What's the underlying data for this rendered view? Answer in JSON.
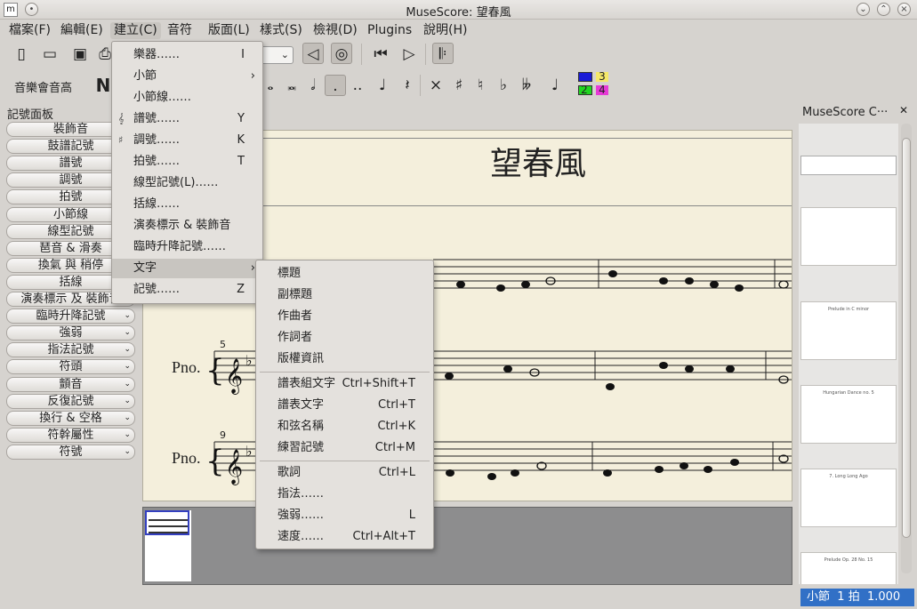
{
  "app": {
    "title": "MuseScore: 望春風"
  },
  "menubar": [
    {
      "label": "檔案(F)"
    },
    {
      "label": "編輯(E)"
    },
    {
      "label": "建立(C)"
    },
    {
      "label": "音符"
    },
    {
      "label": "版面(L)"
    },
    {
      "label": "樣式(S)"
    },
    {
      "label": "檢視(D)"
    },
    {
      "label": "Plugins"
    },
    {
      "label": "說明(H)"
    }
  ],
  "toolbar": {
    "concert_pitch": "音樂會音高",
    "voice_labels": [
      "3",
      "2",
      "4"
    ],
    "voice_colors": [
      "#1a1ad6",
      "#21d621",
      "#e63ad6"
    ]
  },
  "palette": {
    "title": "記號面板",
    "items": [
      "裝飾音",
      "鼓譜記號",
      "譜號",
      "調號",
      "拍號",
      "小節線",
      "線型記號",
      "琶音 & 滑奏",
      "換氣 與 稍停",
      "括線",
      "演奏標示 及 裝飾音",
      "臨時升降記號",
      "強弱",
      "指法記號",
      "符頭",
      "顫音",
      "反復記號",
      "換行 & 空格",
      "符幹屬性",
      "符號"
    ]
  },
  "score": {
    "title": "望春風",
    "instrument": "Pno.",
    "measure_numbers": [
      "5",
      "9"
    ]
  },
  "right_panel": {
    "title": "MuseScore C···",
    "thumbs": [
      "",
      "Prelude in C minor",
      "Hungarian Dance no. 5",
      "7. Long Long Ago",
      "Prelude Op. 28 No. 15"
    ]
  },
  "status": {
    "measure": "小節",
    "measure_val": "1",
    "beat": "拍",
    "beat_val": "1.000"
  },
  "create_menu": [
    {
      "label": "樂器……",
      "shortcut": "I",
      "icon": ""
    },
    {
      "label": "小節",
      "shortcut": "",
      "icon": "",
      "submenu": true
    },
    {
      "label": "小節線……",
      "shortcut": "",
      "icon": ""
    },
    {
      "label": "譜號……",
      "shortcut": "Y",
      "icon": "𝄞"
    },
    {
      "label": "調號……",
      "shortcut": "K",
      "icon": "♯"
    },
    {
      "label": "拍號……",
      "shortcut": "T",
      "icon": ""
    },
    {
      "label": "線型記號(L)……",
      "shortcut": "",
      "icon": ""
    },
    {
      "label": "括線……",
      "shortcut": "",
      "icon": ""
    },
    {
      "label": "演奏標示 & 裝飾音",
      "shortcut": "",
      "icon": ""
    },
    {
      "label": "臨時升降記號……",
      "shortcut": "",
      "icon": ""
    },
    {
      "label": "文字",
      "shortcut": "",
      "icon": "",
      "submenu": true
    },
    {
      "label": "記號……",
      "shortcut": "Z",
      "icon": ""
    }
  ],
  "text_menu": [
    {
      "label": "標題",
      "shortcut": ""
    },
    {
      "label": "副標題",
      "shortcut": ""
    },
    {
      "label": "作曲者",
      "shortcut": ""
    },
    {
      "label": "作詞者",
      "shortcut": ""
    },
    {
      "label": "版權資訊",
      "shortcut": ""
    },
    {
      "label": "譜表組文字",
      "shortcut": "Ctrl+Shift+T"
    },
    {
      "label": "譜表文字",
      "shortcut": "Ctrl+T"
    },
    {
      "label": "和弦名稱",
      "shortcut": "Ctrl+K"
    },
    {
      "label": "練習記號",
      "shortcut": "Ctrl+M"
    },
    {
      "label": "歌詞",
      "shortcut": "Ctrl+L"
    },
    {
      "label": "指法……",
      "shortcut": ""
    },
    {
      "label": "強弱……",
      "shortcut": "L"
    },
    {
      "label": "速度……",
      "shortcut": "Ctrl+Alt+T"
    }
  ]
}
